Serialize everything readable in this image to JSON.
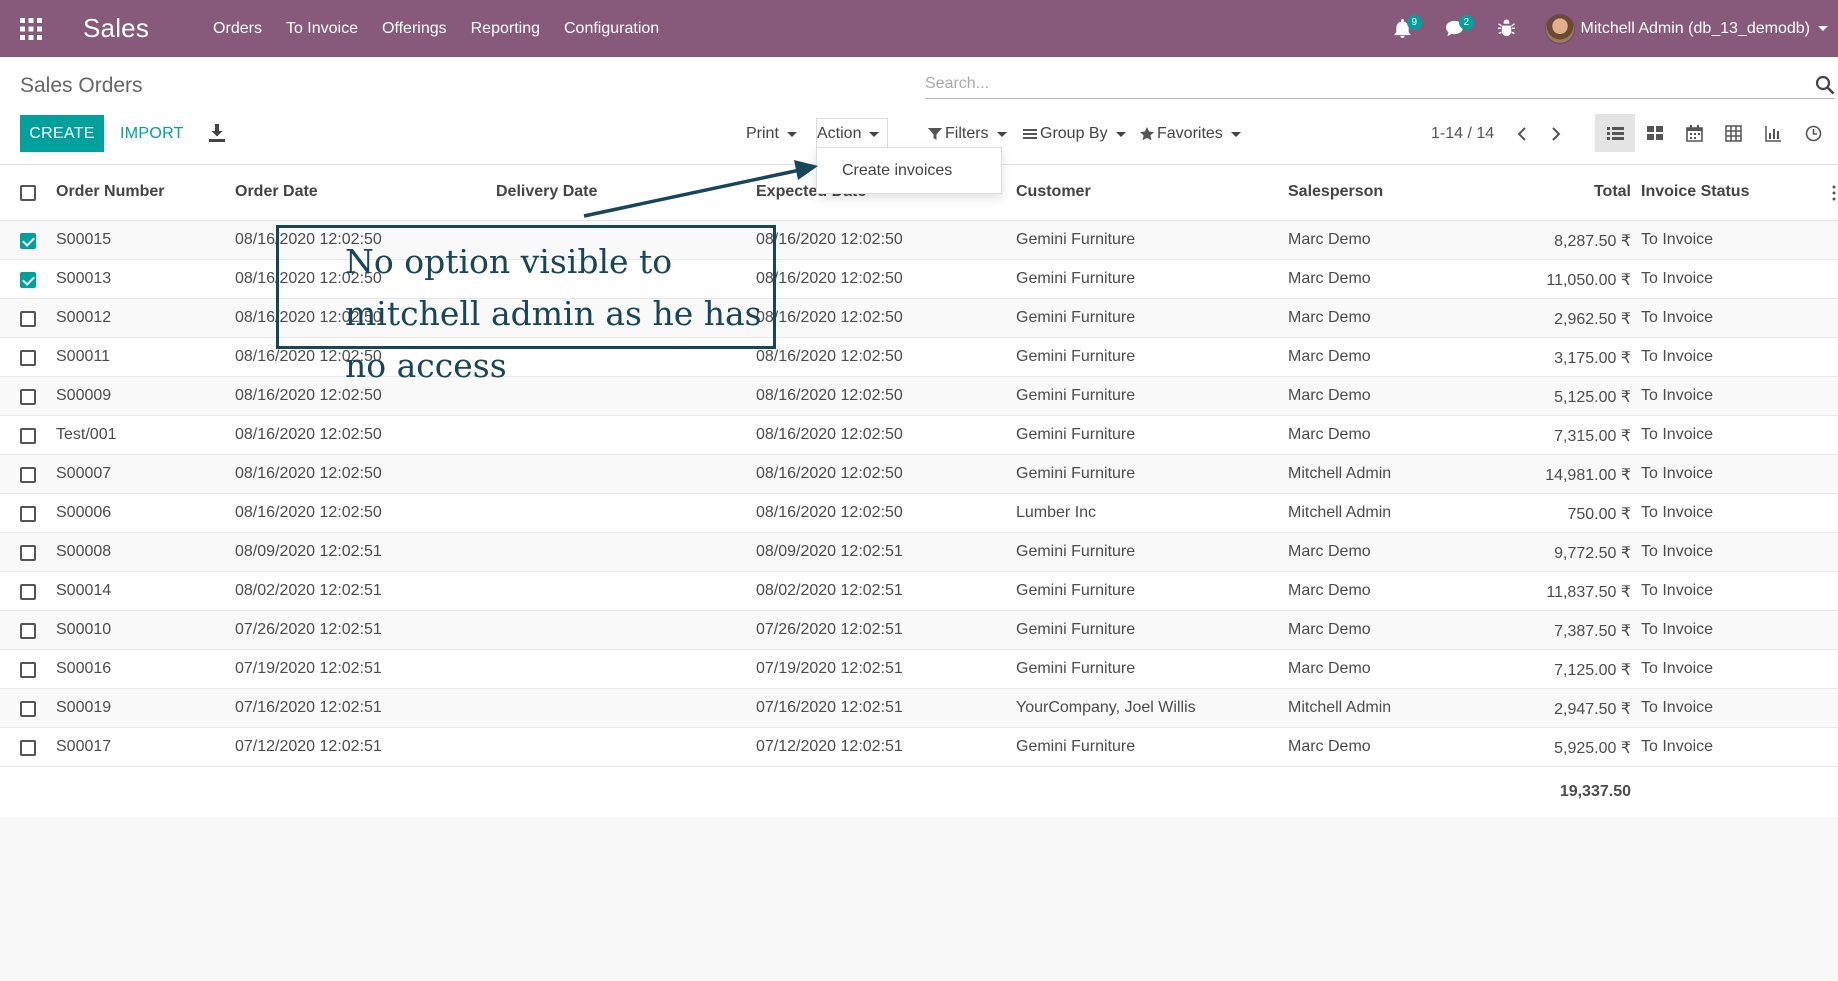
{
  "app": {
    "name": "Sales",
    "menu": [
      "Orders",
      "To Invoice",
      "Offerings",
      "Reporting",
      "Configuration"
    ],
    "notifications": {
      "activities": "9",
      "messages": "2"
    },
    "user": "Mitchell Admin (db_13_demodb)"
  },
  "control": {
    "title": "Sales Orders",
    "search_placeholder": "Search...",
    "create_label": "CREATE",
    "import_label": "IMPORT",
    "print_label": "Print",
    "action_label": "Action",
    "filters_label": "Filters",
    "groupby_label": "Group By",
    "favorites_label": "Favorites",
    "pager": "1-14 / 14"
  },
  "action_dropdown": {
    "items": [
      "Create invoices"
    ]
  },
  "table": {
    "headers": [
      "Order Number",
      "Order Date",
      "Delivery Date",
      "Expected Date",
      "Customer",
      "Salesperson",
      "Total",
      "Invoice Status"
    ],
    "rows": [
      {
        "checked": true,
        "number": "S00015",
        "order_date": "08/16/2020 12:02:50",
        "delivery": "",
        "expected": "08/16/2020 12:02:50",
        "customer": "Gemini Furniture",
        "salesperson": "Marc Demo",
        "total": "8,287.50 ₹",
        "status": "To Invoice"
      },
      {
        "checked": true,
        "number": "S00013",
        "order_date": "08/16/2020 12:02:50",
        "delivery": "",
        "expected": "08/16/2020 12:02:50",
        "customer": "Gemini Furniture",
        "salesperson": "Marc Demo",
        "total": "11,050.00 ₹",
        "status": "To Invoice"
      },
      {
        "checked": false,
        "number": "S00012",
        "order_date": "08/16/2020 12:02:50",
        "delivery": "",
        "expected": "08/16/2020 12:02:50",
        "customer": "Gemini Furniture",
        "salesperson": "Marc Demo",
        "total": "2,962.50 ₹",
        "status": "To Invoice"
      },
      {
        "checked": false,
        "number": "S00011",
        "order_date": "08/16/2020 12:02:50",
        "delivery": "",
        "expected": "08/16/2020 12:02:50",
        "customer": "Gemini Furniture",
        "salesperson": "Marc Demo",
        "total": "3,175.00 ₹",
        "status": "To Invoice"
      },
      {
        "checked": false,
        "number": "S00009",
        "order_date": "08/16/2020 12:02:50",
        "delivery": "",
        "expected": "08/16/2020 12:02:50",
        "customer": "Gemini Furniture",
        "salesperson": "Marc Demo",
        "total": "5,125.00 ₹",
        "status": "To Invoice"
      },
      {
        "checked": false,
        "number": "Test/001",
        "order_date": "08/16/2020 12:02:50",
        "delivery": "",
        "expected": "08/16/2020 12:02:50",
        "customer": "Gemini Furniture",
        "salesperson": "Marc Demo",
        "total": "7,315.00 ₹",
        "status": "To Invoice"
      },
      {
        "checked": false,
        "number": "S00007",
        "order_date": "08/16/2020 12:02:50",
        "delivery": "",
        "expected": "08/16/2020 12:02:50",
        "customer": "Gemini Furniture",
        "salesperson": "Mitchell Admin",
        "total": "14,981.00 ₹",
        "status": "To Invoice"
      },
      {
        "checked": false,
        "number": "S00006",
        "order_date": "08/16/2020 12:02:50",
        "delivery": "",
        "expected": "08/16/2020 12:02:50",
        "customer": "Lumber Inc",
        "salesperson": "Mitchell Admin",
        "total": "750.00 ₹",
        "status": "To Invoice"
      },
      {
        "checked": false,
        "number": "S00008",
        "order_date": "08/09/2020 12:02:51",
        "delivery": "",
        "expected": "08/09/2020 12:02:51",
        "customer": "Gemini Furniture",
        "salesperson": "Marc Demo",
        "total": "9,772.50 ₹",
        "status": "To Invoice"
      },
      {
        "checked": false,
        "number": "S00014",
        "order_date": "08/02/2020 12:02:51",
        "delivery": "",
        "expected": "08/02/2020 12:02:51",
        "customer": "Gemini Furniture",
        "salesperson": "Marc Demo",
        "total": "11,837.50 ₹",
        "status": "To Invoice"
      },
      {
        "checked": false,
        "number": "S00010",
        "order_date": "07/26/2020 12:02:51",
        "delivery": "",
        "expected": "07/26/2020 12:02:51",
        "customer": "Gemini Furniture",
        "salesperson": "Marc Demo",
        "total": "7,387.50 ₹",
        "status": "To Invoice"
      },
      {
        "checked": false,
        "number": "S00016",
        "order_date": "07/19/2020 12:02:51",
        "delivery": "",
        "expected": "07/19/2020 12:02:51",
        "customer": "Gemini Furniture",
        "salesperson": "Marc Demo",
        "total": "7,125.00 ₹",
        "status": "To Invoice"
      },
      {
        "checked": false,
        "number": "S00019",
        "order_date": "07/16/2020 12:02:51",
        "delivery": "",
        "expected": "07/16/2020 12:02:51",
        "customer": "YourCompany, Joel Willis",
        "salesperson": "Mitchell Admin",
        "total": "2,947.50 ₹",
        "status": "To Invoice"
      },
      {
        "checked": false,
        "number": "S00017",
        "order_date": "07/12/2020 12:02:51",
        "delivery": "",
        "expected": "07/12/2020 12:02:51",
        "customer": "Gemini Furniture",
        "salesperson": "Marc Demo",
        "total": "5,925.00 ₹",
        "status": "To Invoice"
      }
    ],
    "selected_total": "19,337.50"
  },
  "annotation": {
    "text": "No option visible to mitchell admin as he has no access",
    "color": "#17465a"
  },
  "colors": {
    "navbar": "#875a7b",
    "primary": "#00a09d"
  }
}
